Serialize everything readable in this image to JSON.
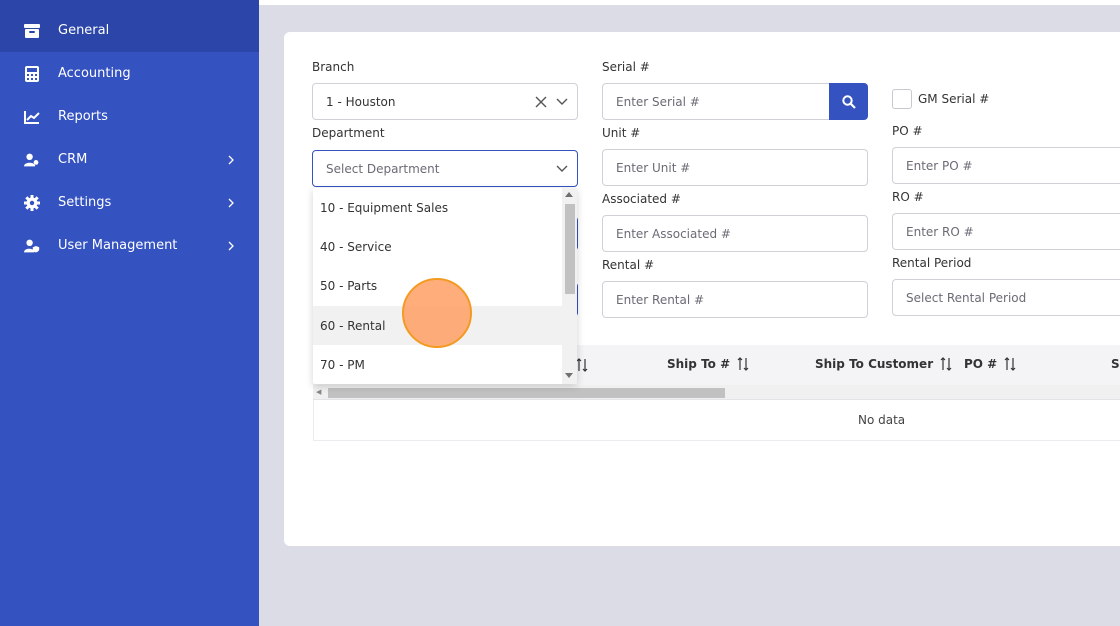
{
  "sidebar": {
    "items": [
      {
        "label": "General",
        "icon": "archive-icon",
        "active": true
      },
      {
        "label": "Accounting",
        "icon": "calculator-icon"
      },
      {
        "label": "Reports",
        "icon": "chart-line-icon"
      },
      {
        "label": "CRM",
        "icon": "users-icon",
        "expandable": true
      },
      {
        "label": "Settings",
        "icon": "gear-icon",
        "expandable": true
      },
      {
        "label": "User Management",
        "icon": "user-shield-icon",
        "expandable": true
      }
    ]
  },
  "form": {
    "branch_label": "Branch",
    "branch_value": "1 - Houston",
    "department_label": "Department",
    "department_placeholder": "Select Department",
    "serial_label": "Serial #",
    "serial_placeholder": "Enter Serial #",
    "gm_serial_label": "GM Serial #",
    "unit_label": "Unit #",
    "unit_placeholder": "Enter Unit #",
    "po_label": "PO #",
    "po_placeholder": "Enter PO #",
    "associated_label": "Associated #",
    "associated_placeholder": "Enter Associated #",
    "ro_label": "RO #",
    "ro_placeholder": "Enter RO #",
    "rental_label": "Rental #",
    "rental_placeholder": "Enter Rental #",
    "rental_period_label": "Rental Period",
    "rental_period_placeholder": "Select Rental Period"
  },
  "department_dropdown": {
    "options": [
      "10 - Equipment Sales",
      "40 - Service",
      "50 - Parts",
      "60 - Rental",
      "70 - PM"
    ],
    "hovered_index": 3
  },
  "table": {
    "columns": [
      "Ship To #",
      "Ship To Customer",
      "PO #",
      "S"
    ],
    "empty_text": "No data"
  },
  "colors": {
    "sidebar": "#3452c0",
    "sidebar_active": "#2b45a8",
    "accent": "#3452c0",
    "cursor": "#f39a22"
  }
}
